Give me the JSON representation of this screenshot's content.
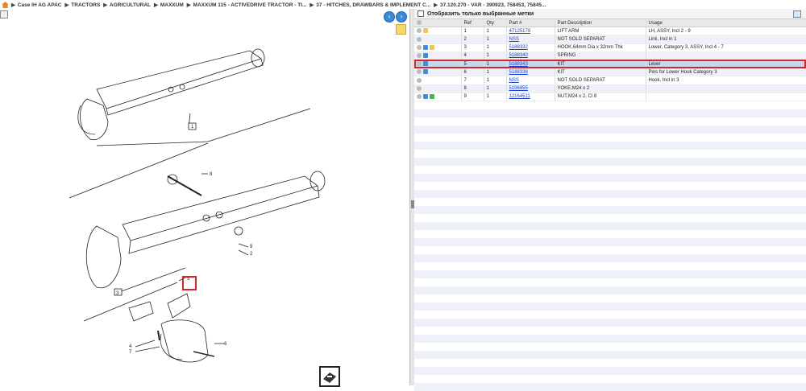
{
  "breadcrumb": [
    "Case IH AG APAC",
    "TRACTORS",
    "AGRICULTURAL",
    "MAXXUM",
    "MAXXUM 115 - ACTIVEDRIVE TRACTOR - TI...",
    "37 - HITCHES, DRAWBARS & IMPLEMENT C...",
    "37.120.270 - VAR - 390923, 758453, 75845..."
  ],
  "filter": {
    "label": "Отобразить только выбранные метки"
  },
  "table": {
    "headers": [
      "",
      "Ref",
      "Qty",
      "Part #",
      "Part Description",
      "Usage"
    ],
    "rows": [
      {
        "ref": "1",
        "qty": "1",
        "part": "47125178",
        "desc": "LIFT ARM",
        "usage": "LH, ASSY, Incl 2 - 9"
      },
      {
        "ref": "2",
        "qty": "1",
        "part": "NSS",
        "desc": "NOT SOLD SEPARAT",
        "usage": "Link, Incl in 1"
      },
      {
        "ref": "3",
        "qty": "1",
        "part": "5188332",
        "desc": "HOOK,64mm Dia x 32mm Thk",
        "usage": "Lower, Category 3, ASSY, Incl 4 - 7"
      },
      {
        "ref": "4",
        "qty": "1",
        "part": "5188340",
        "desc": "SPRING",
        "usage": ""
      },
      {
        "ref": "5",
        "qty": "1",
        "part": "5188343",
        "desc": "KIT",
        "usage": "Lever"
      },
      {
        "ref": "6",
        "qty": "1",
        "part": "5188338",
        "desc": "KIT",
        "usage": "Pins for Lower Hook Category 3"
      },
      {
        "ref": "7",
        "qty": "1",
        "part": "NSS",
        "desc": "NOT SOLD SEPARAT",
        "usage": "Hook, Incl in 3"
      },
      {
        "ref": "8",
        "qty": "1",
        "part": "5196955",
        "desc": "YOKE,M24 x 2",
        "usage": ""
      },
      {
        "ref": "9",
        "qty": "1",
        "part": "12164511",
        "desc": "NUT,M24 x 2, Cl 8",
        "usage": ""
      }
    ]
  },
  "diagram": {
    "labels": [
      "1",
      "2",
      "3",
      "4",
      "5",
      "6",
      "7",
      "8",
      "9"
    ]
  }
}
